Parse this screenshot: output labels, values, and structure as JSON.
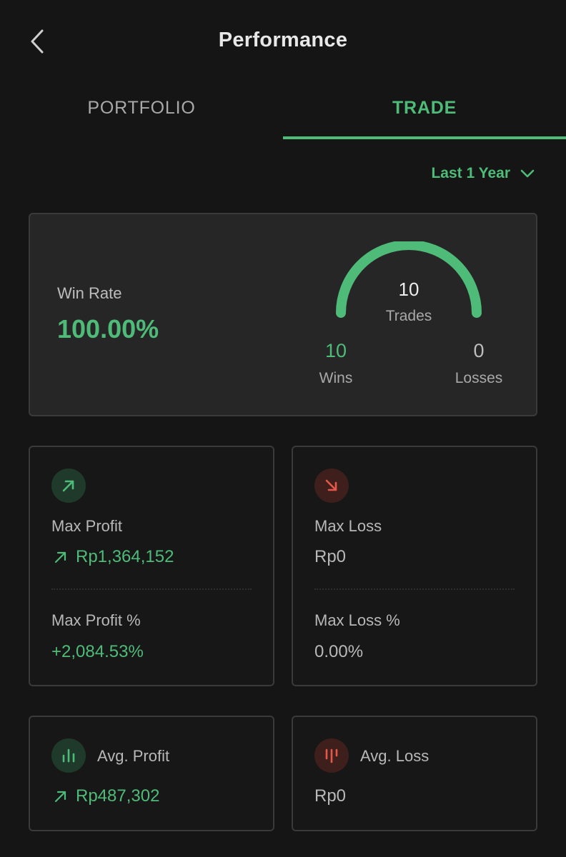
{
  "header": {
    "title": "Performance",
    "back_icon": "chevron-left-icon"
  },
  "tabs": [
    {
      "label": "PORTFOLIO",
      "active": false
    },
    {
      "label": "TRADE",
      "active": true
    }
  ],
  "period_filter": {
    "label": "Last 1 Year",
    "icon": "chevron-down-icon"
  },
  "win_rate": {
    "label": "Win Rate",
    "value": "100.00%",
    "trades_count": "10",
    "trades_label": "Trades",
    "wins_count": "10",
    "wins_label": "Wins",
    "losses_count": "0",
    "losses_label": "Losses",
    "win_fraction": 1.0
  },
  "max_profit": {
    "label": "Max Profit",
    "value": "Rp1,364,152",
    "pct_label": "Max Profit %",
    "pct_value": "+2,084.53%",
    "icon": "arrow-up-right-icon"
  },
  "max_loss": {
    "label": "Max Loss",
    "value": "Rp0",
    "pct_label": "Max Loss %",
    "pct_value": "0.00%",
    "icon": "arrow-down-right-icon"
  },
  "avg_profit": {
    "label": "Avg. Profit",
    "value": "Rp487,302",
    "icon": "bar-chart-up-icon"
  },
  "avg_loss": {
    "label": "Avg. Loss",
    "value": "Rp0",
    "icon": "bar-chart-down-icon"
  },
  "colors": {
    "accent_green": "#4fbb78",
    "loss_red": "#e4574a",
    "background": "#151515",
    "card": "#262626"
  }
}
